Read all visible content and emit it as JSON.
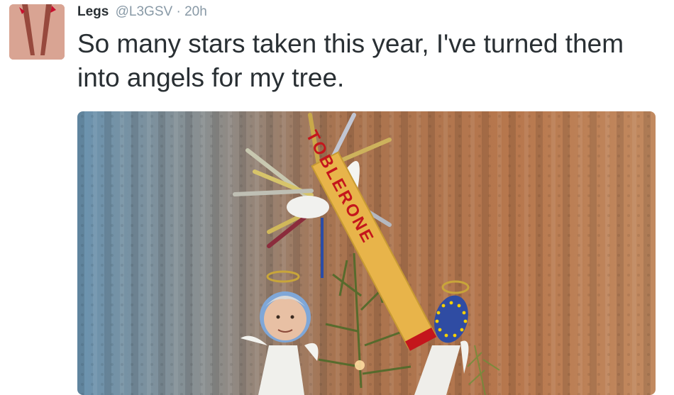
{
  "tweet": {
    "display_name": "Legs",
    "handle": "@L3GSV",
    "separator": "·",
    "timestamp": "20h",
    "text": "So many stars taken this year, I've turned them into angels for my tree."
  },
  "photo": {
    "toblerone_label": "TOBLERONE"
  },
  "icons": {
    "avatar": "profile-photo-legs",
    "eu_flag": "eu-flag-angel"
  },
  "colors": {
    "name": "#292f33",
    "meta": "#8899a6",
    "toblerone": "#e8b44a",
    "toblerone_text": "#c4161c",
    "eu_blue": "#2f4ca3",
    "eu_star": "#f5d000"
  }
}
